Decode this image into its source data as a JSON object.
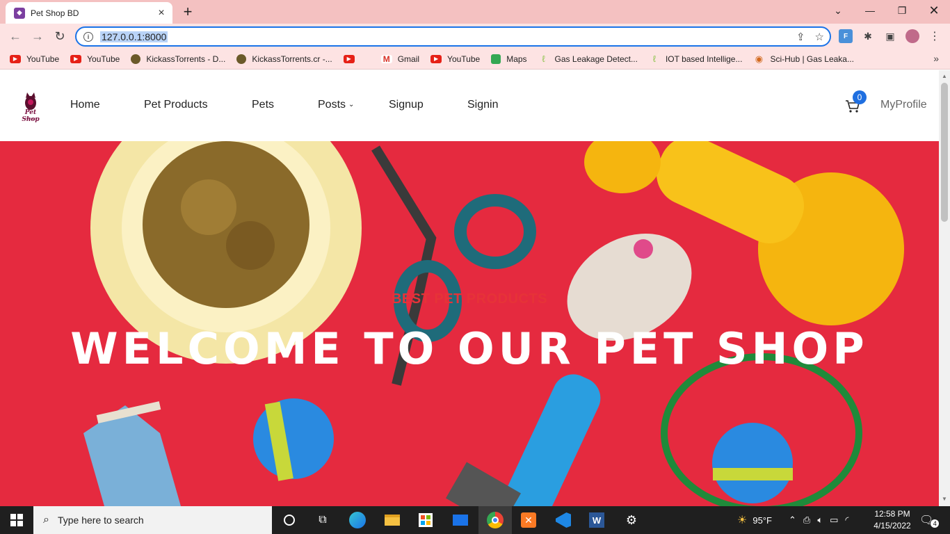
{
  "browser": {
    "tab_title": "Pet Shop BD",
    "url": "127.0.0.1:8000",
    "bookmarks": [
      {
        "label": "YouTube",
        "icon": "youtube-icon"
      },
      {
        "label": "YouTube",
        "icon": "youtube-icon"
      },
      {
        "label": "KickassTorrents - D...",
        "icon": "kickass-icon"
      },
      {
        "label": "KickassTorrents.cr -...",
        "icon": "kickass-icon"
      },
      {
        "label": "",
        "icon": "youtube-icon"
      },
      {
        "label": "Gmail",
        "icon": "gmail-icon"
      },
      {
        "label": "YouTube",
        "icon": "youtube-icon"
      },
      {
        "label": "Maps",
        "icon": "maps-icon"
      },
      {
        "label": "Gas Leakage Detect...",
        "icon": "leaf-icon"
      },
      {
        "label": "IOT based Intellige...",
        "icon": "leaf-icon"
      },
      {
        "label": "Sci-Hub | Gas Leaka...",
        "icon": "scihub-icon"
      }
    ]
  },
  "site": {
    "nav": {
      "home": "Home",
      "pet_products": "Pet Products",
      "pets": "Pets",
      "posts": "Posts",
      "signup": "Signup",
      "signin": "Signin",
      "cart_count": "0",
      "my_profile": "MyProfile"
    },
    "logo": {
      "text": "Pet Shop",
      "sub": "PetShop"
    },
    "hero": {
      "subtitle": "BEST PET PRODUCTS",
      "title": "WELCOME TO OUR PET SHOP"
    }
  },
  "taskbar": {
    "search_placeholder": "Type here to search",
    "weather": "95°F",
    "time": "12:58 PM",
    "date": "4/15/2022",
    "notifications": "4"
  },
  "colors": {
    "hero_bg": "#e52a3f",
    "accent": "#1f6fe0",
    "titlebar": "#f4c1c1"
  }
}
